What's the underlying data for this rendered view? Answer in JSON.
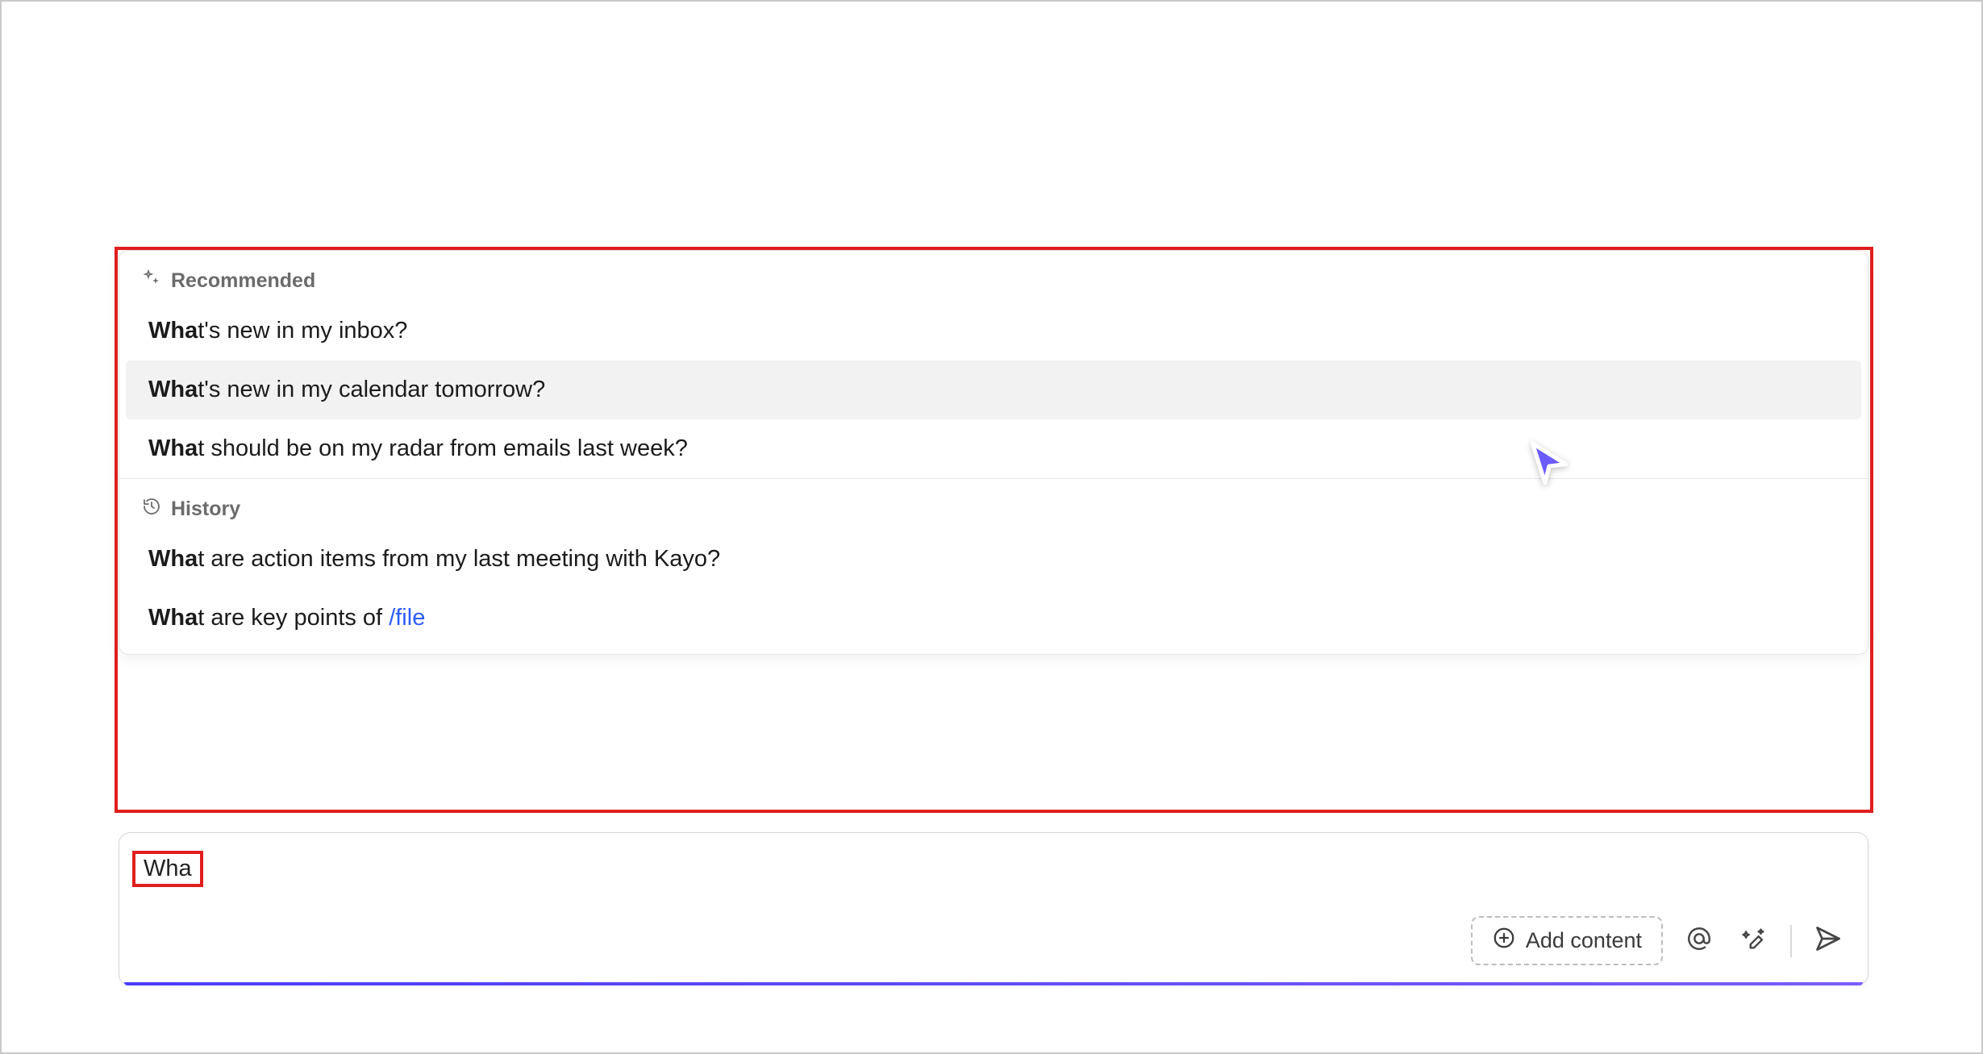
{
  "suggestions_panel": {
    "sections": [
      {
        "key": "recommended",
        "icon": "sparkles-icon",
        "label": "Recommended",
        "items": [
          {
            "match": "Wha",
            "rest": "t's new in my inbox?",
            "hovered": false
          },
          {
            "match": "Wha",
            "rest": "t's new in my calendar tomorrow?",
            "hovered": true
          },
          {
            "match": "Wha",
            "rest": "t should be on my radar from emails last week?",
            "hovered": false
          }
        ]
      },
      {
        "key": "history",
        "icon": "history-icon",
        "label": "History",
        "items": [
          {
            "match": "Wha",
            "rest": "t are action items from my last meeting with Kayo?",
            "hovered": false
          },
          {
            "match": "Wha",
            "rest": "t are key points of ",
            "link": "/file",
            "hovered": false
          }
        ]
      }
    ]
  },
  "input": {
    "typed": "Wha"
  },
  "toolbar": {
    "add_content_label": "Add content",
    "mention_icon": "mention-icon",
    "rewrite_icon": "rewrite-icon",
    "send_icon": "send-icon"
  },
  "cursor": {
    "color": "#6b5cff"
  },
  "annotations": {
    "suggestions_highlight": true,
    "typed_highlight": true
  }
}
